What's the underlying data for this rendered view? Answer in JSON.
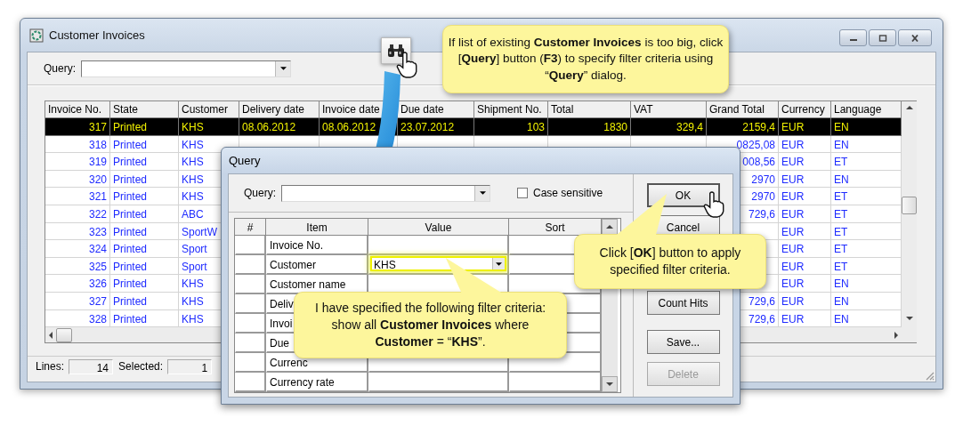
{
  "window": {
    "title": "Customer Invoices",
    "query_label": "Query:"
  },
  "table": {
    "columns": [
      {
        "label": "Invoice No.",
        "kind": "number"
      },
      {
        "label": "State",
        "kind": "text"
      },
      {
        "label": "Customer",
        "kind": "text"
      },
      {
        "label": "Delivery date",
        "kind": "text"
      },
      {
        "label": "Invoice date",
        "kind": "text"
      },
      {
        "label": "Due date",
        "kind": "text"
      },
      {
        "label": "Shipment No.",
        "kind": "number"
      },
      {
        "label": "Total",
        "kind": "number"
      },
      {
        "label": "VAT",
        "kind": "number"
      },
      {
        "label": "Grand Total",
        "kind": "number"
      },
      {
        "label": "Currency",
        "kind": "text"
      },
      {
        "label": "Language",
        "kind": "text"
      }
    ],
    "rows": [
      {
        "selected": true,
        "cells": [
          "317",
          "Printed",
          "KHS",
          "08.06.2012",
          "08.06.2012",
          "23.07.2012",
          "103",
          "1830",
          "329,4",
          "2159,4",
          "EUR",
          "EN"
        ]
      },
      {
        "selected": false,
        "cells": [
          "318",
          "Printed",
          "KHS",
          null,
          null,
          null,
          null,
          null,
          null,
          "0825,08",
          "EUR",
          "EN"
        ]
      },
      {
        "selected": false,
        "cells": [
          "319",
          "Printed",
          "KHS",
          null,
          null,
          null,
          null,
          null,
          null,
          "008,56",
          "EUR",
          "ET"
        ]
      },
      {
        "selected": false,
        "cells": [
          "320",
          "Printed",
          "KHS",
          null,
          null,
          null,
          null,
          null,
          null,
          "2970",
          "EUR",
          "EN"
        ]
      },
      {
        "selected": false,
        "cells": [
          "321",
          "Printed",
          "KHS",
          null,
          null,
          null,
          null,
          null,
          null,
          "2970",
          "EUR",
          "ET"
        ]
      },
      {
        "selected": false,
        "cells": [
          "322",
          "Printed",
          "ABC",
          null,
          null,
          null,
          null,
          null,
          null,
          "729,6",
          "EUR",
          "ET"
        ]
      },
      {
        "selected": false,
        "cells": [
          "323",
          "Printed",
          "SportW",
          null,
          null,
          null,
          null,
          null,
          null,
          null,
          "EUR",
          "ET"
        ]
      },
      {
        "selected": false,
        "cells": [
          "324",
          "Printed",
          "Sport",
          null,
          null,
          null,
          null,
          null,
          null,
          null,
          "EUR",
          "ET"
        ]
      },
      {
        "selected": false,
        "cells": [
          "325",
          "Printed",
          "Sport",
          null,
          null,
          null,
          null,
          null,
          null,
          null,
          "EUR",
          "ET"
        ]
      },
      {
        "selected": false,
        "cells": [
          "326",
          "Printed",
          "KHS",
          null,
          null,
          null,
          null,
          null,
          null,
          null,
          "EUR",
          "EN"
        ]
      },
      {
        "selected": false,
        "cells": [
          "327",
          "Printed",
          "KHS",
          null,
          null,
          null,
          null,
          null,
          null,
          "729,6",
          "EUR",
          "EN"
        ]
      },
      {
        "selected": false,
        "cells": [
          "328",
          "Printed",
          "KHS",
          null,
          null,
          null,
          null,
          null,
          null,
          "729,6",
          "EUR",
          "EN"
        ]
      }
    ]
  },
  "status_bar": [
    {
      "label": "Lines:",
      "value": "14"
    },
    {
      "label": "Selected:",
      "value": "1"
    }
  ],
  "dialog": {
    "title": "Query",
    "query_label": "Query:",
    "case_sensitive": {
      "label": "Case sensitive",
      "checked": false
    },
    "grid": {
      "columns": [
        "#",
        "Item",
        "Value",
        "Sort"
      ],
      "rows": [
        {
          "item": "Invoice No."
        },
        {
          "item": "Customer",
          "value": "KHS",
          "highlighted": true
        },
        {
          "item": "Customer name"
        },
        {
          "item": "Deliv"
        },
        {
          "item": "Invoi"
        },
        {
          "item": "Due"
        },
        {
          "item": "Currenc"
        },
        {
          "item": "Currency rate"
        }
      ]
    },
    "buttons": [
      {
        "label": "OK",
        "default": true,
        "disabled": false
      },
      {
        "label": "Cancel",
        "default": false,
        "disabled": false
      },
      {
        "label": "Count Hits",
        "default": false,
        "disabled": false
      },
      {
        "label": "Save...",
        "default": false,
        "disabled": false
      },
      {
        "label": "Delete",
        "default": false,
        "disabled": true
      }
    ]
  },
  "callouts": [
    {
      "kind": "top",
      "text": "If list of existing **Customer Invoices** is too big, click [**Query**] button (**F3**) to specify filter criteria using “**Query**” dialog."
    },
    {
      "kind": "ok",
      "text": "Click [**OK**] button to apply specified filter criteria."
    },
    {
      "kind": "value",
      "text": "I have specified the following filter criteria: show all **Customer Invoices** where **Customer** = “**KHS**”."
    }
  ]
}
